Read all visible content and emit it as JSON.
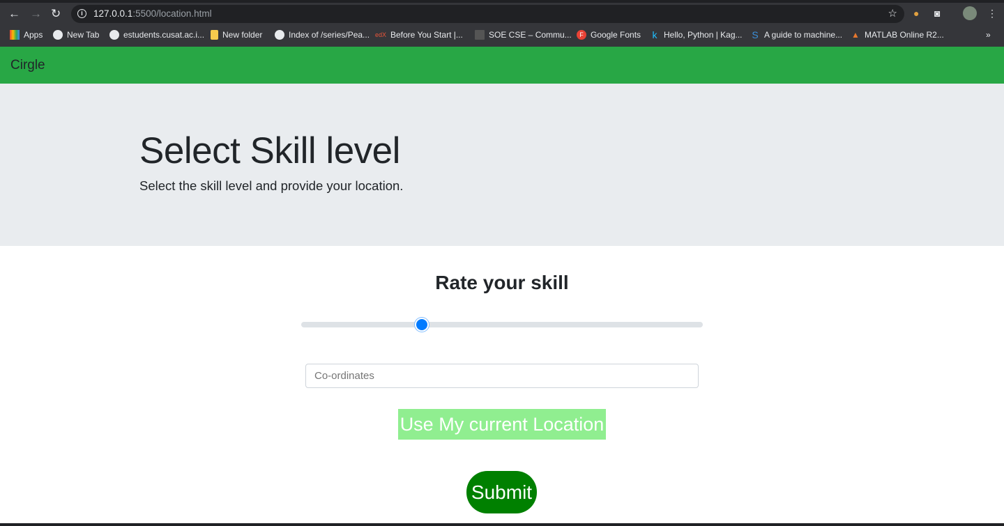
{
  "browser": {
    "url_host": "127.0.0.1",
    "url_rest": ":5500/location.html",
    "bookmarks": [
      "Apps",
      "New Tab",
      "estudents.cusat.ac.i...",
      "New folder",
      "Index of /series/Pea...",
      "Before You Start |...",
      "SOE CSE – Commu...",
      "Google Fonts",
      "Hello, Python | Kag...",
      "A guide to machine...",
      "MATLAB Online R2..."
    ],
    "overflow": "»"
  },
  "navbar": {
    "brand": "Cirgle",
    "color": "#28a745"
  },
  "jumbotron": {
    "title": "Select Skill level",
    "lead": "Select the skill level and provide your location."
  },
  "form": {
    "heading": "Rate your skill",
    "skill_slider": {
      "min": 0,
      "max": 100,
      "value": 30
    },
    "coordinates_placeholder": "Co-ordinates",
    "location_button": "Use My current Location",
    "submit_button": "Submit"
  }
}
